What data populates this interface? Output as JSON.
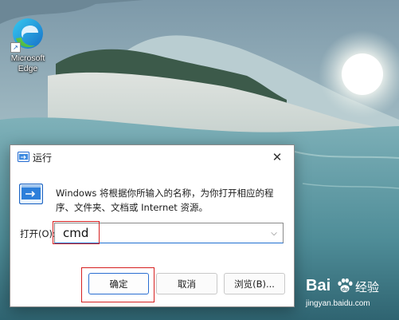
{
  "desktop": {
    "edge_icon": {
      "label_line1": "Microsoft",
      "label_line2": "Edge",
      "icon": "edge-icon"
    }
  },
  "run_dialog": {
    "title": "运行",
    "close_glyph": "✕",
    "description": "Windows 将根据你所输入的名称，为你打开相应的程序、文件夹、文档或 Internet 资源。",
    "open_label": "打开(O):",
    "input_value": "cmd",
    "buttons": {
      "ok": "确定",
      "cancel": "取消",
      "browse": "浏览(B)..."
    },
    "accent_color": "#2a6ed1",
    "annotation_color": "#d62020"
  },
  "watermark": {
    "brand": "Bai",
    "brand_suffix": "经验",
    "url": "jingyan.baidu.com"
  }
}
